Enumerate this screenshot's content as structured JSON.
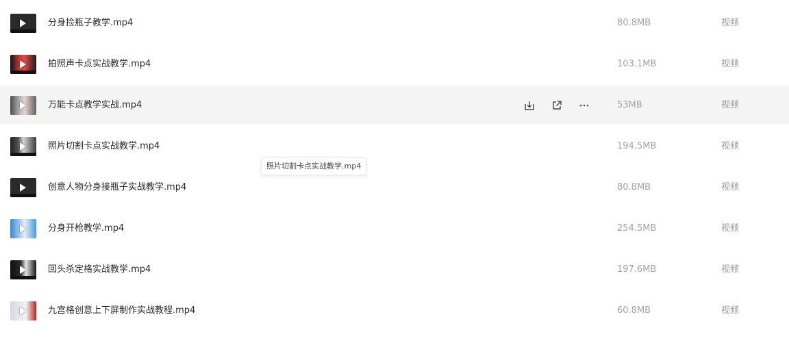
{
  "files": [
    {
      "name": "分身捡瓶子教学.mp4",
      "size": "80.8MB",
      "type": "视频",
      "thumb_style": "dark"
    },
    {
      "name": "拍照声卡点实战教学.mp4",
      "size": "103.1MB",
      "type": "视频",
      "thumb_style": "red"
    },
    {
      "name": "万能卡点教学实战.mp4",
      "size": "53MB",
      "type": "视频",
      "thumb_style": "face"
    },
    {
      "name": "照片切割卡点实战教学.mp4",
      "size": "194.5MB",
      "type": "视频",
      "thumb_style": "grid"
    },
    {
      "name": "创意人物分身接瓶子实战教学.mp4",
      "size": "80.8MB",
      "type": "视频",
      "thumb_style": "dark"
    },
    {
      "name": "分身开枪教学.mp4",
      "size": "254.5MB",
      "type": "视频",
      "thumb_style": "blue"
    },
    {
      "name": "回头杀定格实战教学.mp4",
      "size": "197.6MB",
      "type": "视频",
      "thumb_style": "bw"
    },
    {
      "name": "九宫格创意上下屏制作实战教程.mp4",
      "size": "60.8MB",
      "type": "视频",
      "thumb_style": "paper"
    }
  ],
  "hovered_row": 2,
  "row_actions": [
    {
      "icon": "download-icon"
    },
    {
      "icon": "share-icon"
    },
    {
      "icon": "more-icon"
    }
  ],
  "tooltip": {
    "text": "照片切割卡点实战教学.mp4"
  },
  "colors": {
    "row_hover_bg": "#f4f4f5",
    "name_text": "#2a2a2a",
    "meta_text": "#a3a3a3"
  }
}
